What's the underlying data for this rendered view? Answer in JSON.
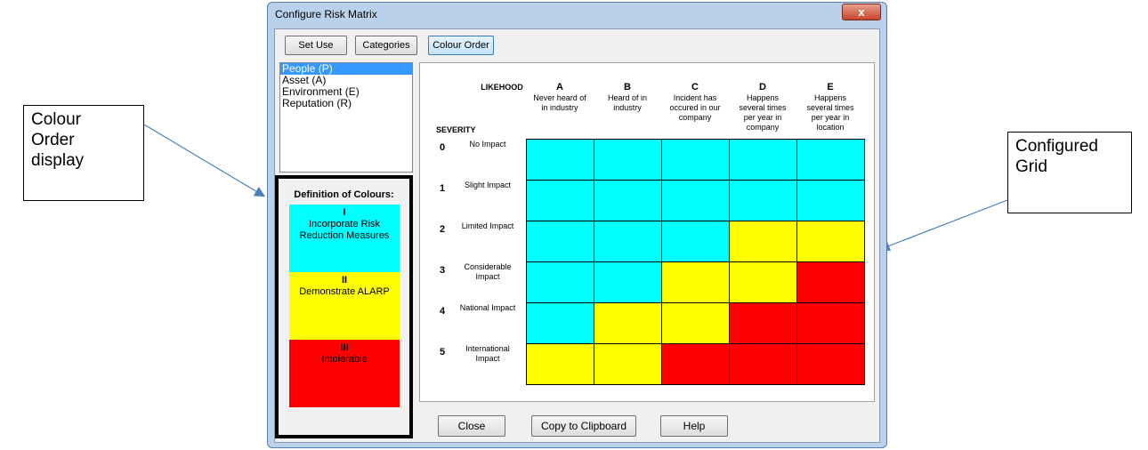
{
  "window": {
    "title": "Configure Risk Matrix",
    "close_glyph": "x"
  },
  "toolbar": {
    "set_use": "Set Use",
    "categories": "Categories",
    "colour_order": "Colour Order"
  },
  "categories": [
    {
      "label": "People (P)",
      "selected": true
    },
    {
      "label": "Asset (A)",
      "selected": false
    },
    {
      "label": "Environment (E)",
      "selected": false
    },
    {
      "label": "Reputation (R)",
      "selected": false
    }
  ],
  "legend": {
    "title": "Definition of Colours:",
    "items": [
      {
        "numeral": "I",
        "text": "Incorporate Risk Reduction Measures",
        "color": "#00ffff"
      },
      {
        "numeral": "II",
        "text": "Demonstrate ALARP",
        "color": "#ffff00"
      },
      {
        "numeral": "III",
        "text": "Intolerable",
        "color": "#ff0000"
      }
    ]
  },
  "matrix": {
    "likelihood_label": "LIKEHOOD",
    "severity_label": "SEVERITY",
    "columns": [
      {
        "letter": "A",
        "desc": "Never heard of in industry"
      },
      {
        "letter": "B",
        "desc": "Heard of in industry"
      },
      {
        "letter": "C",
        "desc": "Incident has occured in our company"
      },
      {
        "letter": "D",
        "desc": "Happens several times per year in company"
      },
      {
        "letter": "E",
        "desc": "Happens several times per year in location"
      }
    ],
    "rows": [
      {
        "num": "0",
        "desc": "No Impact",
        "cells": [
          "I",
          "I",
          "I",
          "I",
          "I"
        ]
      },
      {
        "num": "1",
        "desc": "Slight Impact",
        "cells": [
          "I",
          "I",
          "I",
          "I",
          "I"
        ]
      },
      {
        "num": "2",
        "desc": "Limited Impact",
        "cells": [
          "I",
          "I",
          "I",
          "II",
          "II"
        ]
      },
      {
        "num": "3",
        "desc": "Considerable Impact",
        "cells": [
          "I",
          "I",
          "II",
          "II",
          "III"
        ]
      },
      {
        "num": "4",
        "desc": "National Impact",
        "cells": [
          "I",
          "II",
          "II",
          "III",
          "III"
        ]
      },
      {
        "num": "5",
        "desc": "International Impact",
        "cells": [
          "II",
          "II",
          "III",
          "III",
          "III"
        ]
      }
    ],
    "colors": {
      "I": "#00ffff",
      "II": "#ffff00",
      "III": "#ff0000"
    }
  },
  "footer": {
    "close": "Close",
    "copy": "Copy to Clipboard",
    "help": "Help"
  },
  "annotations": {
    "left": "Colour Order display",
    "right": "Configured Grid"
  }
}
